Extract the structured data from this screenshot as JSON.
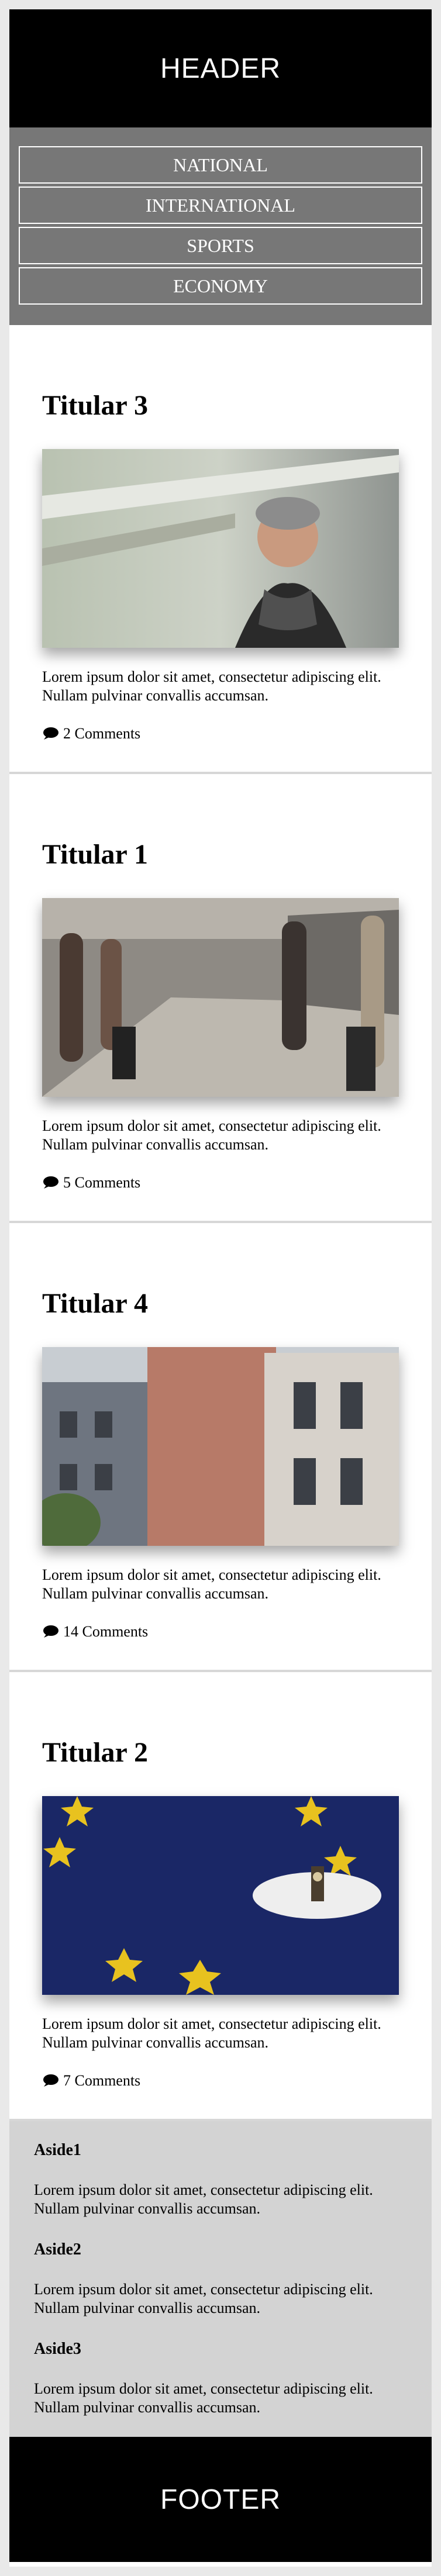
{
  "header": {
    "label": "HEADER"
  },
  "nav": {
    "items": [
      "NATIONAL",
      "INTERNATIONAL",
      "SPORTS",
      "ECONOMY"
    ]
  },
  "articles": [
    {
      "title": "Titular 3",
      "excerpt": "Lorem ipsum dolor sit amet, consectetur adipiscing elit. Nullam pulvinar convallis accumsan.",
      "comments": "2 Comments",
      "photo": "man-with-scarf-photo"
    },
    {
      "title": "Titular 1",
      "excerpt": "Lorem ipsum dolor sit amet, consectetur adipiscing elit. Nullam pulvinar convallis accumsan.",
      "comments": "5 Comments",
      "photo": "train-platform-photo"
    },
    {
      "title": "Titular 4",
      "excerpt": "Lorem ipsum dolor sit amet, consectetur adipiscing elit. Nullam pulvinar convallis accumsan.",
      "comments": "14 Comments",
      "photo": "city-buildings-photo"
    },
    {
      "title": "Titular 2",
      "excerpt": "Lorem ipsum dolor sit amet, consectetur adipiscing elit. Nullam pulvinar convallis accumsan.",
      "comments": "7 Comments",
      "photo": "eu-flag-big-ben-photo"
    }
  ],
  "asides": [
    {
      "title": "Aside1",
      "text": "Lorem ipsum dolor sit amet, consectetur adipiscing elit. Nullam pulvinar convallis accumsan."
    },
    {
      "title": "Aside2",
      "text": "Lorem ipsum dolor sit amet, consectetur adipiscing elit. Nullam pulvinar convallis accumsan."
    },
    {
      "title": "Aside3",
      "text": "Lorem ipsum dolor sit amet, consectetur adipiscing elit. Nullam pulvinar convallis accumsan."
    }
  ],
  "footer": {
    "label": "FOOTER"
  },
  "colors": {
    "header_bg": "#000000",
    "nav_bg": "#777777",
    "aside_bg": "#d3d3d3",
    "page_bg": "#e9e9e9"
  }
}
